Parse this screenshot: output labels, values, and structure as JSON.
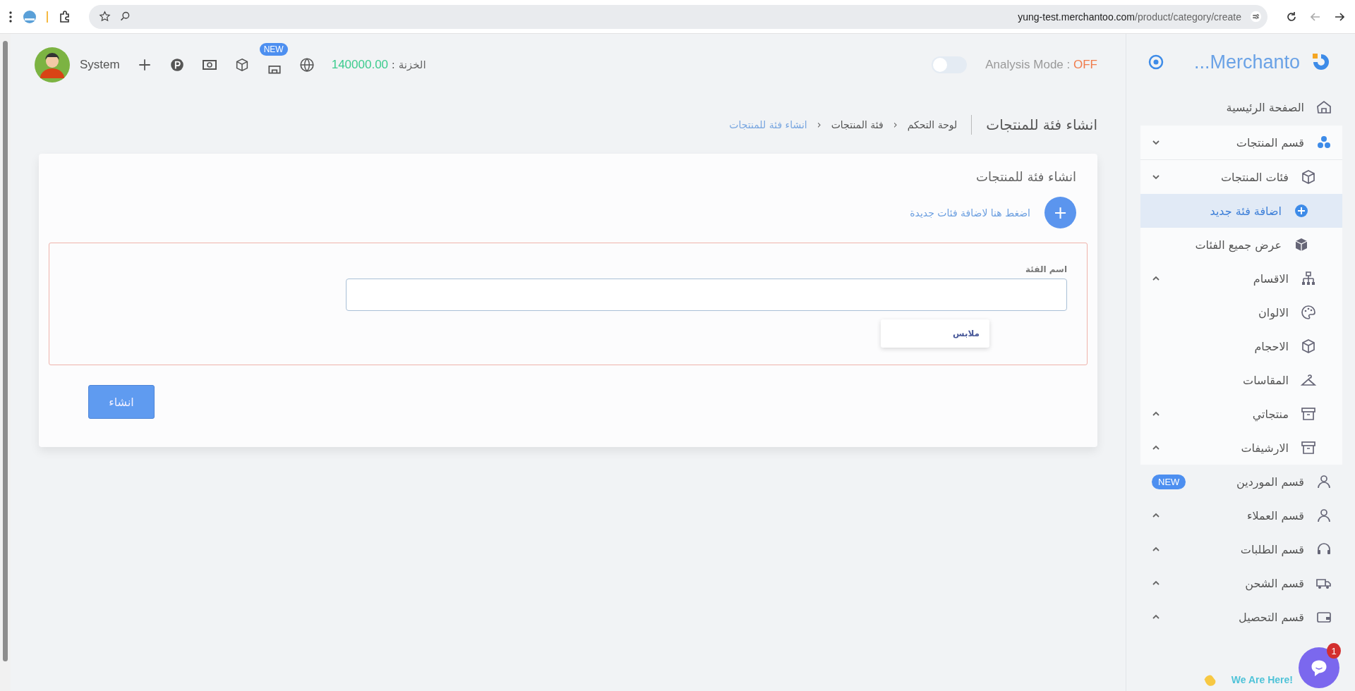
{
  "browser": {
    "url_host": "yung-test.merchantoo.com",
    "url_path": "/product/category/create"
  },
  "header": {
    "user": "System",
    "new_badge": "NEW",
    "treasury_label": "الخزنة : ",
    "treasury_value": "140000.00",
    "analysis_label": "Analysis Mode : ",
    "analysis_value": "OFF",
    "analysis_on": false
  },
  "sidebar": {
    "brand": "...Merchanto",
    "items": [
      {
        "label": "الصفحة الرئيسية",
        "selected": false
      },
      {
        "label": "قسم المنتجات",
        "expanded": true,
        "selected": false,
        "children": [
          {
            "label": "فئات المنتجات",
            "expanded": true,
            "selected": false,
            "children": [
              {
                "label": "اضافة فئة جديد",
                "selected": true
              },
              {
                "label": "عرض جميع الفئات",
                "selected": false
              }
            ]
          },
          {
            "label": "الاقسام",
            "expanded": false,
            "selected": false
          },
          {
            "label": "الالوان",
            "selected": false
          },
          {
            "label": "الاحجام",
            "selected": false
          },
          {
            "label": "المقاسات",
            "selected": false
          },
          {
            "label": "منتجاتي",
            "expanded": false,
            "selected": false
          },
          {
            "label": "الارشيفات",
            "expanded": false,
            "selected": false
          }
        ]
      },
      {
        "label": "قسم الموردين",
        "badge": "NEW",
        "selected": false
      },
      {
        "label": "قسم العملاء",
        "expanded": false,
        "selected": false
      },
      {
        "label": "قسم الطلبات",
        "expanded": false,
        "selected": false
      },
      {
        "label": "قسم الشحن",
        "expanded": false,
        "selected": false
      },
      {
        "label": "قسم التحصيل",
        "expanded": false,
        "selected": false
      }
    ]
  },
  "page_title": "انشاء فئة للمنتجات",
  "breadcrumbs": [
    {
      "label": "لوحة التحكم",
      "current": false
    },
    {
      "label": "فئة المنتجات",
      "current": false
    },
    {
      "label": "انشاء فئة للمنتجات",
      "current": true
    }
  ],
  "breadcrumb_separator": "‹",
  "card": {
    "title": "انشاء فئة للمنتجات",
    "add_button": "+",
    "add_link": "اضغط هنا لاضافة فئات جديدة",
    "field": {
      "label": "اسم الفئة",
      "suggestions": [
        "ملابس"
      ]
    },
    "submit": "انشاء"
  },
  "chat": {
    "tagline": "We Are Here!",
    "unread": "1"
  }
}
